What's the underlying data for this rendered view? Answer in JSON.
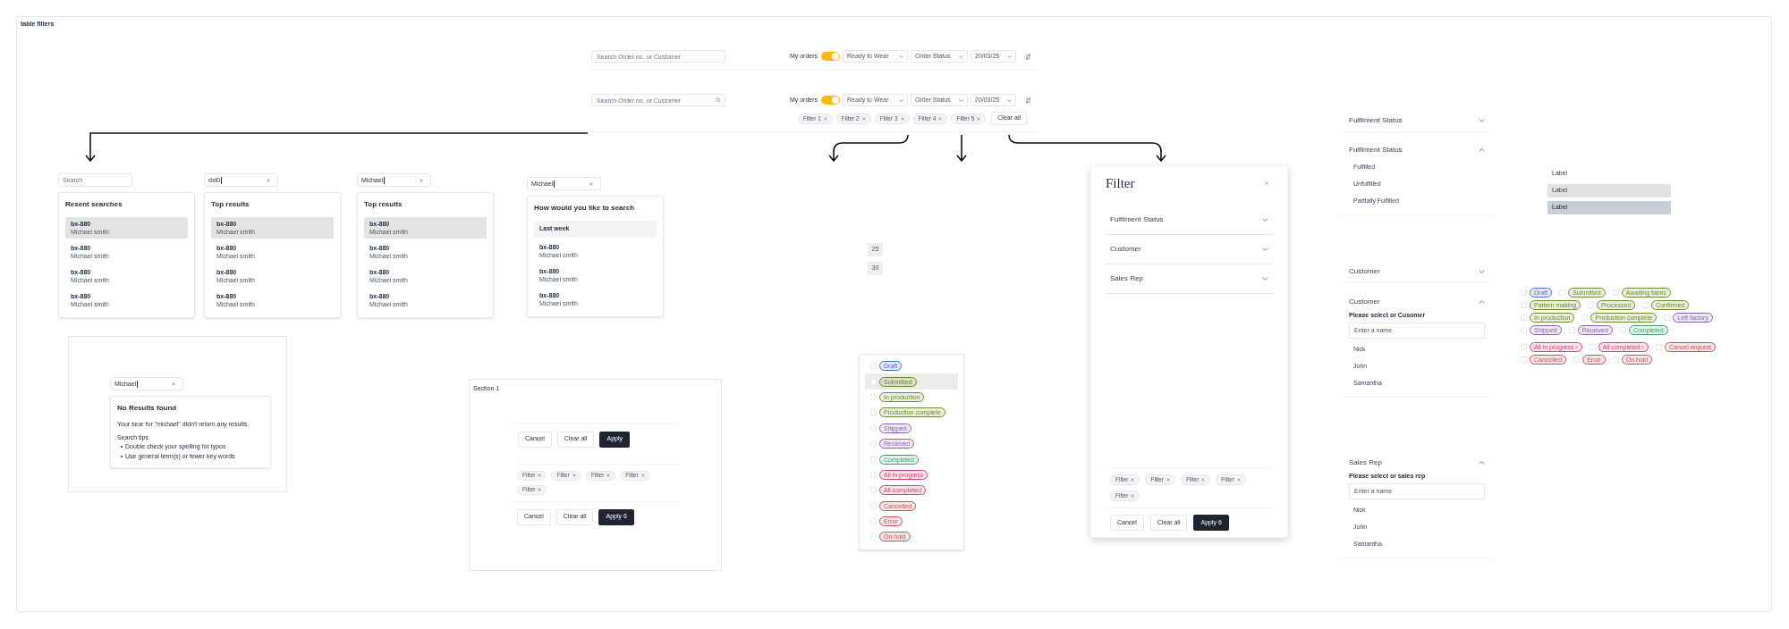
{
  "canvas": {
    "title": "table filters"
  },
  "filter_bars": [
    {
      "kind": "basic",
      "search": {
        "placeholder": "Search Order no. or Customer"
      },
      "my_orders": {
        "label": "My orders",
        "on": true
      },
      "dropdowns": [
        "Ready to Wear",
        "Order Status",
        "20/03/25"
      ]
    },
    {
      "kind": "with-chips",
      "search": {
        "placeholder": "Search Order no. or Customer"
      },
      "my_orders": {
        "label": "My orders",
        "on": true
      },
      "dropdowns": [
        "Ready to Wear",
        "Order Status",
        "20/03/25"
      ],
      "chips": [
        "Filter 1",
        "Filter 2",
        "Filter 3",
        "Filter 4",
        "Filter 5"
      ],
      "clear_button": "Clear all"
    }
  ],
  "search_dropdowns": [
    {
      "field": {
        "placeholder": "Search"
      },
      "heading": "Resent searches",
      "results": [
        {
          "code": "bx-880",
          "name": "Michael smith",
          "selected": true
        },
        {
          "code": "bx-880",
          "name": "Michael smith",
          "selected": false
        },
        {
          "code": "bx-880",
          "name": "Michael smith",
          "selected": false
        },
        {
          "code": "bx-880",
          "name": "Michael smith",
          "selected": false
        }
      ]
    },
    {
      "field": {
        "value": "dxt0"
      },
      "heading": "Top results",
      "results": [
        {
          "code": "bx-880",
          "name": "Michael smith",
          "selected": true
        },
        {
          "code": "bx-880",
          "name": "Michael smith",
          "selected": false
        },
        {
          "code": "bx-880",
          "name": "Michael smith",
          "selected": false
        },
        {
          "code": "bx-880",
          "name": "Michael smith",
          "selected": false
        }
      ]
    },
    {
      "field": {
        "value": "Michael"
      },
      "heading": "Top results",
      "results": [
        {
          "code": "bx-880",
          "name": "Michael smith",
          "selected": true
        },
        {
          "code": "bx-880",
          "name": "Michael smith",
          "selected": false
        },
        {
          "code": "bx-880",
          "name": "Michael smith",
          "selected": false
        },
        {
          "code": "bx-880",
          "name": "Michael smith",
          "selected": false
        }
      ]
    },
    {
      "field": {
        "value": "Michael"
      },
      "heading": "How would you like to search",
      "suggestion": "Last week",
      "results": [
        {
          "code": "bx-880",
          "name": "Michael smith",
          "selected": false
        },
        {
          "code": "bx-880",
          "name": "Michael smith",
          "selected": false
        },
        {
          "code": "bx-880",
          "name": "Michael smith",
          "selected": false
        }
      ]
    }
  ],
  "no_results": {
    "field": {
      "value": "Michael"
    },
    "heading": "No Results found",
    "message": "Your sear for \"michael\" didn't return any results.",
    "tips_heading": "Search tips",
    "tips": [
      "Double check your spelling for typos",
      "Use general term(s) or fewer key words"
    ]
  },
  "section": {
    "title": "Section 1",
    "first_buttons": [
      {
        "label": "Cancel",
        "kind": "secondary"
      },
      {
        "label": "Clear all",
        "kind": "secondary"
      },
      {
        "label": "Apply",
        "kind": "primary"
      }
    ],
    "chips": [
      "Filter",
      "Filter",
      "Filter",
      "Filter",
      "Filter"
    ],
    "second_buttons": [
      {
        "label": "Cancel",
        "kind": "secondary"
      },
      {
        "label": "Clear all",
        "kind": "secondary"
      },
      {
        "label": "Apply 6",
        "kind": "primary"
      }
    ]
  },
  "page_sizes": [
    "25",
    "30"
  ],
  "status_list": [
    {
      "label": "Draft",
      "color": "#4a72c8",
      "checked": false,
      "selected": false
    },
    {
      "label": "Submitted",
      "color": "#6e8b2c",
      "checked": false,
      "selected": true
    },
    {
      "label": "In production",
      "color": "#6e8b2c",
      "checked": false,
      "selected": false
    },
    {
      "label": "Production complete",
      "color": "#6e8b2c",
      "checked": false,
      "selected": false
    },
    {
      "label": "Shipped",
      "color": "#8a63b0",
      "checked": false,
      "selected": false
    },
    {
      "label": "Received",
      "color": "#8a63b0",
      "checked": false,
      "selected": false
    },
    {
      "label": "Completed",
      "color": "#3f9f6e",
      "checked": false,
      "selected": false
    },
    {
      "label": "All in progress",
      "color": "#d2427a",
      "checked": false,
      "selected": false
    },
    {
      "label": "All completed",
      "color": "#d2427a",
      "checked": false,
      "selected": false
    },
    {
      "label": "Cancelled",
      "color": "#c4525a",
      "checked": false,
      "selected": false
    },
    {
      "label": "Error",
      "color": "#c4525a",
      "checked": false,
      "selected": false
    },
    {
      "label": "On hold",
      "color": "#c4525a",
      "checked": false,
      "selected": false
    }
  ],
  "filter_panel": {
    "title": "Filter",
    "sections": [
      {
        "label": "Fulfilment Status",
        "expanded": false
      },
      {
        "label": "Customer",
        "expanded": false
      },
      {
        "label": "Sales Rep",
        "expanded": false
      }
    ],
    "chips": [
      "Filter",
      "Filter",
      "Filter",
      "Filter",
      "Filter"
    ],
    "buttons": [
      {
        "label": "Cancel",
        "kind": "secondary"
      },
      {
        "label": "Clear all",
        "kind": "secondary"
      },
      {
        "label": "Apply 6",
        "kind": "primary"
      }
    ]
  },
  "accordions": [
    {
      "title": "Fulfilment Status",
      "expanded": false
    },
    {
      "title": "Fulfilment Status",
      "expanded": true,
      "options": [
        "Fulfilled",
        "Unfulfilled",
        "Partially Fulfilled"
      ]
    },
    {
      "title": "Customer",
      "expanded": false
    },
    {
      "title": "Customer",
      "expanded": true,
      "prompt": "Please select or Cusomer",
      "input": {
        "placeholder": "Enter a name"
      },
      "options": [
        "Nick",
        "John",
        "Samantha"
      ]
    },
    {
      "title": "Sales Rep",
      "expanded": true,
      "prompt": "Please select or sales rep",
      "input": {
        "placeholder": "Enter a name"
      },
      "options": [
        "Nick",
        "John",
        "Samantha"
      ]
    }
  ],
  "label_list": [
    {
      "label": "Label",
      "hovered": false,
      "selected": false
    },
    {
      "label": "Label",
      "hovered": true,
      "selected": false
    },
    {
      "label": "Label",
      "hovered": false,
      "selected": true
    }
  ],
  "tag_rows": [
    [
      {
        "label": "Draft",
        "color": "#4a72c8",
        "checked": false
      },
      {
        "label": "Submitted",
        "color": "#6e8b2c",
        "checked": false
      },
      {
        "label": "Awaiting fabric",
        "color": "#6e8b2c",
        "checked": false
      }
    ],
    [
      {
        "label": "Pattern making",
        "color": "#6e8b2c",
        "checked": false
      },
      {
        "label": "Processed",
        "color": "#6e8b2c",
        "checked": false
      },
      {
        "label": "Confirmed",
        "color": "#6e8b2c",
        "checked": false
      }
    ],
    [
      {
        "label": "In production",
        "color": "#6e8b2c",
        "checked": false
      },
      {
        "label": "Production complete",
        "color": "#6e8b2c",
        "checked": false
      },
      {
        "label": "Left factory",
        "color": "#8a63b0",
        "checked": false
      }
    ],
    [
      {
        "label": "Shipped",
        "color": "#8a63b0",
        "checked": false
      },
      {
        "label": "Received",
        "color": "#8a63b0",
        "checked": false
      },
      {
        "label": "Completed",
        "color": "#3f9f6e",
        "checked": false
      }
    ],
    [
      {
        "label": "All in progress ›",
        "color": "#d2427a",
        "checked": false
      },
      {
        "label": "All completed ›",
        "color": "#d2427a",
        "checked": false
      },
      {
        "label": "Cancel request",
        "color": "#c4525a",
        "checked": false
      }
    ],
    [
      {
        "label": "Cancelled",
        "color": "#c4525a",
        "checked": false
      },
      {
        "label": "Error",
        "color": "#c4525a",
        "checked": false
      },
      {
        "label": "On hold",
        "color": "#c4525a",
        "checked": false
      }
    ]
  ]
}
